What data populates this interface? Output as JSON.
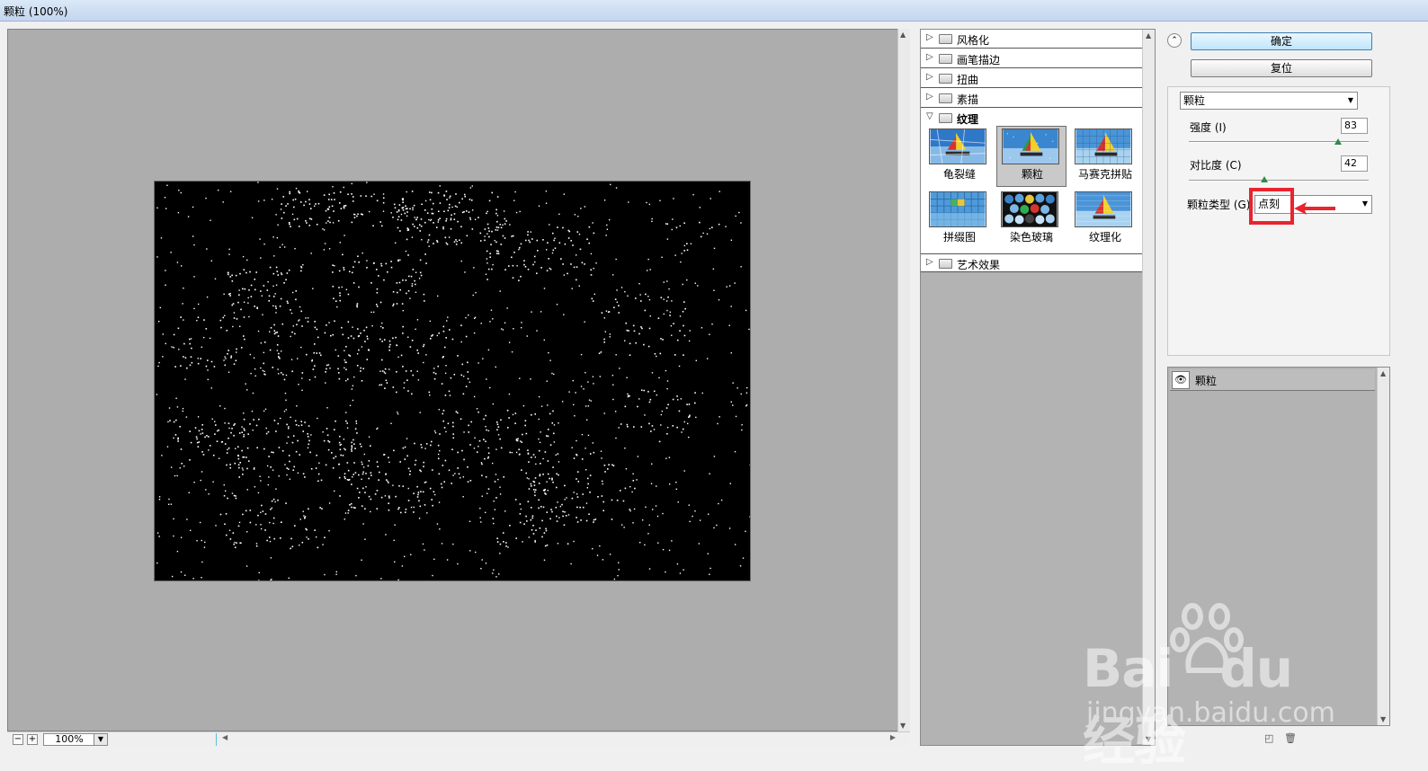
{
  "window": {
    "title": "颗粒 (100%)"
  },
  "preview": {
    "zoom": "100%"
  },
  "gallery": {
    "categories": [
      {
        "label": "风格化",
        "expanded": false
      },
      {
        "label": "画笔描边",
        "expanded": false
      },
      {
        "label": "扭曲",
        "expanded": false
      },
      {
        "label": "素描",
        "expanded": false
      },
      {
        "label": "纹理",
        "expanded": true
      },
      {
        "label": "艺术效果",
        "expanded": false
      }
    ],
    "texture_filters": [
      {
        "label": "龟裂缝",
        "selected": false
      },
      {
        "label": "颗粒",
        "selected": true
      },
      {
        "label": "马赛克拼贴",
        "selected": false
      },
      {
        "label": "拼缀图",
        "selected": false
      },
      {
        "label": "染色玻璃",
        "selected": false
      },
      {
        "label": "纹理化",
        "selected": false
      }
    ]
  },
  "actions": {
    "ok": "确定",
    "reset": "复位"
  },
  "settings": {
    "filter_select": "颗粒",
    "intensity": {
      "label": "强度 (I)",
      "value": "83",
      "fraction": 0.83
    },
    "contrast": {
      "label": "对比度 (C)",
      "value": "42",
      "fraction": 0.42
    },
    "grain_type": {
      "label": "颗粒类型 (G):",
      "value": "点刻"
    }
  },
  "layers": {
    "items": [
      {
        "name": "颗粒",
        "visible": true
      }
    ]
  },
  "watermark": {
    "brand": "Bai",
    "brand2": "du",
    "cn": "经验",
    "url": "jingyan.baidu.com"
  },
  "colors": {
    "highlight": "#e8242e",
    "accent": "#3c7fb1"
  }
}
